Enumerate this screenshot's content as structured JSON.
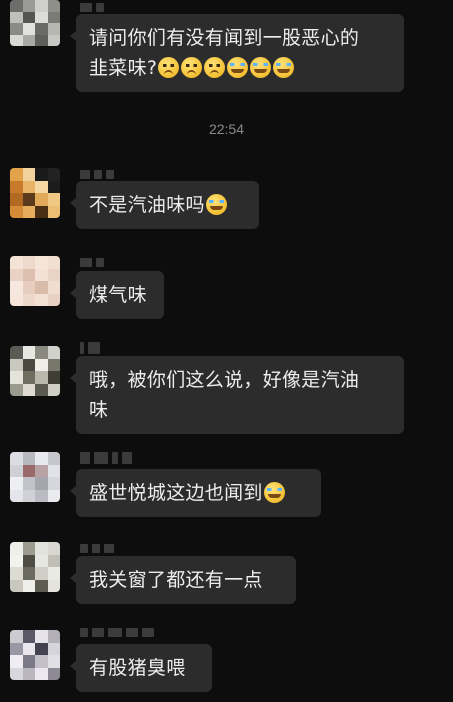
{
  "timestamp": "22:54",
  "messages": [
    {
      "text": "请问你们有没有闻到一股恶心的",
      "text2": "韭菜味?",
      "emojis": [
        "sad",
        "sad",
        "sad",
        "cry",
        "cry",
        "cry"
      ]
    },
    {
      "text": "不是汽油味吗",
      "emojis": [
        "cry"
      ]
    },
    {
      "text": "煤气味",
      "emojis": []
    },
    {
      "text": "哦，被你们这么说，好像是汽油",
      "text2": "味",
      "emojis": []
    },
    {
      "text": "盛世悦城这边也闻到",
      "emojis": [
        "cry"
      ]
    },
    {
      "text": "我关窗了都还有一点",
      "emojis": []
    },
    {
      "text": "有股猪臭喂",
      "emojis": []
    }
  ],
  "colors": {
    "background": "#0d0d0d",
    "bubble": "#2c2c2c",
    "text": "#ededed",
    "timestamp": "#8a8a8a"
  }
}
